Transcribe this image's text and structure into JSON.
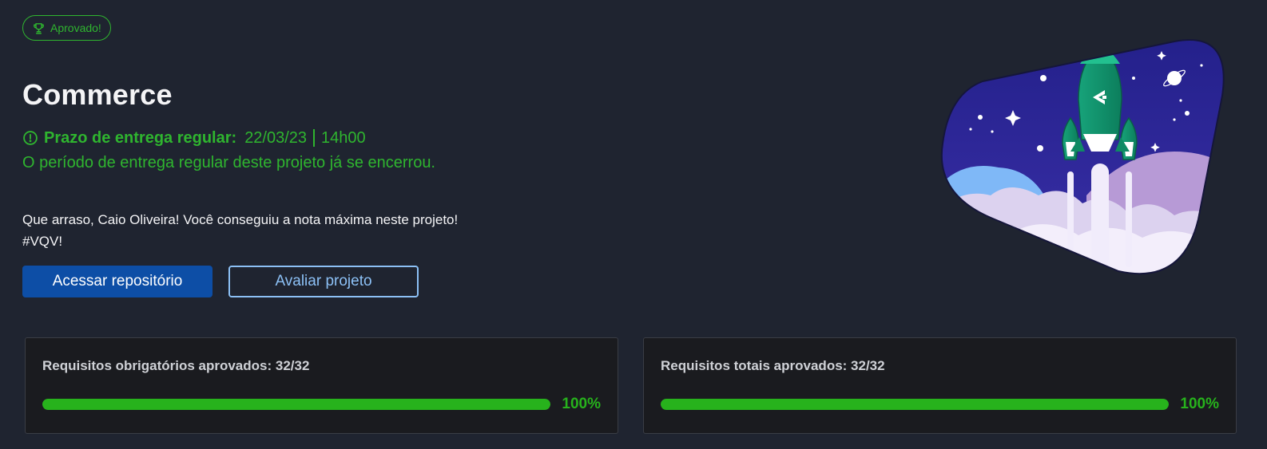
{
  "status": {
    "label": "Aprovado!",
    "icon": "trophy-icon",
    "color": "#2fb52f"
  },
  "project": {
    "title": "Commerce"
  },
  "deadline": {
    "icon": "alert-circle-icon",
    "label": "Prazo de entrega regular:",
    "date": "22/03/23",
    "time": "14h00",
    "closed_message": "O período de entrega regular deste projeto já se encerrou."
  },
  "message": {
    "line1": "Que arraso, Caio Oliveira! Você conseguiu a nota máxima neste projeto!",
    "line2": "#VQV!"
  },
  "actions": {
    "repo_label": "Acessar repositório",
    "evaluate_label": "Avaliar projeto"
  },
  "requirements": [
    {
      "label": "Requisitos obrigatórios aprovados: 32/32",
      "progress": 1.0,
      "percent_label": "100%"
    },
    {
      "label": "Requisitos totais aprovados: 32/32",
      "progress": 1.0,
      "percent_label": "100%"
    }
  ],
  "colors": {
    "background": "#1f2430",
    "success": "#2fb52f",
    "progress": "#27b21c",
    "primary_button": "#0d4ea6",
    "secondary_outline": "#8cc0f5"
  },
  "illustration": {
    "icon": "rocket-launch-illustration"
  }
}
